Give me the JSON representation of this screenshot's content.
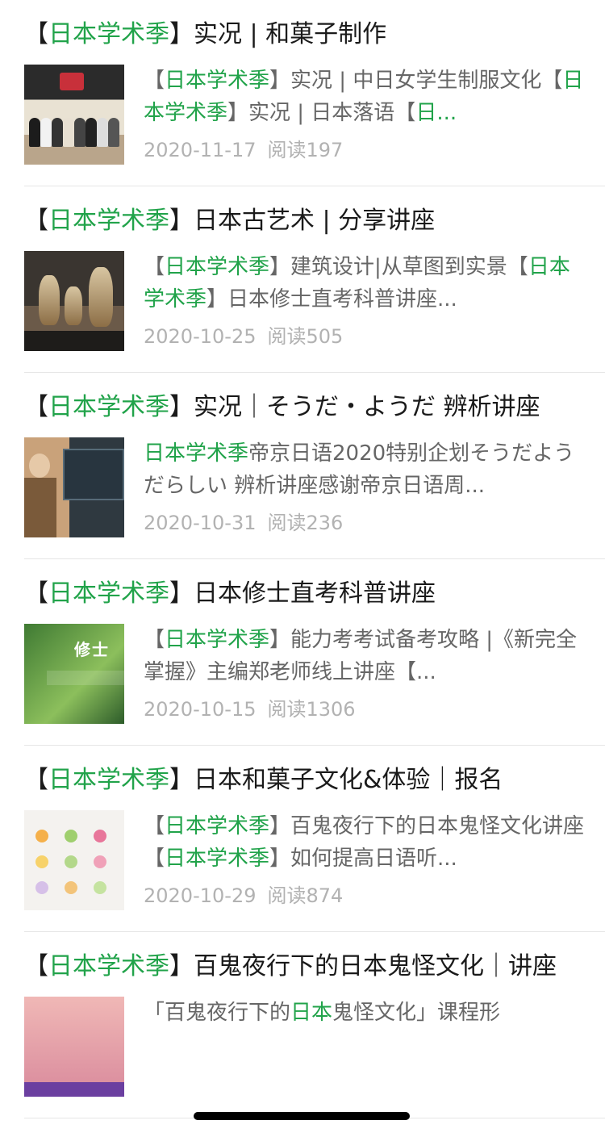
{
  "tag": "日本学术季",
  "bracket_open": "【",
  "bracket_close": "】",
  "articles": [
    {
      "title_rest": "实况 | 和菓子制作",
      "summary": [
        {
          "t": "【",
          "hl": false
        },
        {
          "t": "日本学术季",
          "hl": true
        },
        {
          "t": "】实况 | 中日女学生制服文化【",
          "hl": false
        },
        {
          "t": "日本学术季",
          "hl": true
        },
        {
          "t": "】实况 | 日本落语【",
          "hl": false
        },
        {
          "t": "日...",
          "hl": true
        }
      ],
      "date": "2020-11-17",
      "reads": "阅读197"
    },
    {
      "title_rest": "日本古艺术 | 分享讲座",
      "summary": [
        {
          "t": "【",
          "hl": false
        },
        {
          "t": "日本学术季",
          "hl": true
        },
        {
          "t": "】建筑设计|从草图到实景",
          "hl": false
        },
        {
          "t": "【",
          "hl": false
        },
        {
          "t": "日本学术季",
          "hl": true
        },
        {
          "t": "】日本修士直考科普讲座...",
          "hl": false
        }
      ],
      "date": "2020-10-25",
      "reads": "阅读505"
    },
    {
      "title_rest": "实况｜そうだ・ようだ 辨析讲座",
      "summary": [
        {
          "t": "日本学术季",
          "hl": true
        },
        {
          "t": "帝京日语2020特别企划そうだようだらしい 辨析讲座感谢帝京日语周...",
          "hl": false
        }
      ],
      "date": "2020-10-31",
      "reads": "阅读236"
    },
    {
      "title_rest": "日本修士直考科普讲座",
      "summary": [
        {
          "t": "【",
          "hl": false
        },
        {
          "t": "日本学术季",
          "hl": true
        },
        {
          "t": "】能力考考试备考攻略 |《新完全掌握》主编郑老师线上讲座【...",
          "hl": false
        }
      ],
      "date": "2020-10-15",
      "reads": "阅读1306"
    },
    {
      "title_rest": "日本和菓子文化&体验｜报名",
      "summary": [
        {
          "t": "【",
          "hl": false
        },
        {
          "t": "日本学术季",
          "hl": true
        },
        {
          "t": "】百鬼夜行下的日本鬼怪文化讲座【",
          "hl": false
        },
        {
          "t": "日本学术季",
          "hl": true
        },
        {
          "t": "】如何提高日语听...",
          "hl": false
        }
      ],
      "date": "2020-10-29",
      "reads": "阅读874"
    },
    {
      "title_rest": "百鬼夜行下的日本鬼怪文化｜讲座",
      "summary": [
        {
          "t": "「百鬼夜行下的",
          "hl": false
        },
        {
          "t": "日本",
          "hl": true
        },
        {
          "t": "鬼怪文化」课程形",
          "hl": false
        }
      ],
      "date": "",
      "reads": ""
    }
  ],
  "thumb4_text": "修士"
}
